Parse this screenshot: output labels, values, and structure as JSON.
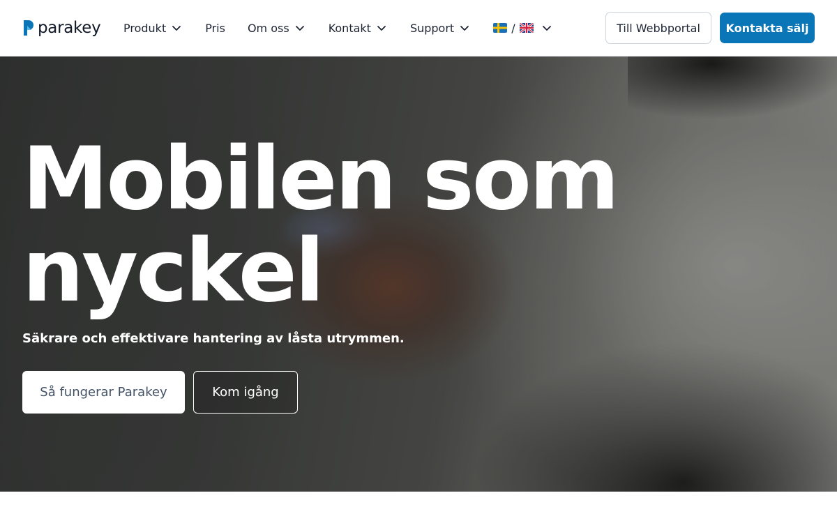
{
  "brand": {
    "name": "parakey",
    "accent": "#0a76b8"
  },
  "nav": {
    "items": [
      {
        "label": "Produkt",
        "has_dropdown": true
      },
      {
        "label": "Pris",
        "has_dropdown": false
      },
      {
        "label": "Om oss",
        "has_dropdown": true
      },
      {
        "label": "Kontakt",
        "has_dropdown": true
      },
      {
        "label": "Support",
        "has_dropdown": true
      }
    ],
    "language": {
      "separator": "/",
      "flags": [
        "sweden-flag-icon",
        "uk-flag-icon"
      ]
    },
    "portal_button": "Till Webbportal",
    "sales_button": "Kontakta sälj"
  },
  "hero": {
    "title_line_1": "Mobilen som",
    "title_line_2": "nyckel",
    "subtitle": "Säkrare och effektivare hantering av låsta utrymmen.",
    "primary_button": "Så fungerar Parakey",
    "secondary_button": "Kom igång"
  }
}
